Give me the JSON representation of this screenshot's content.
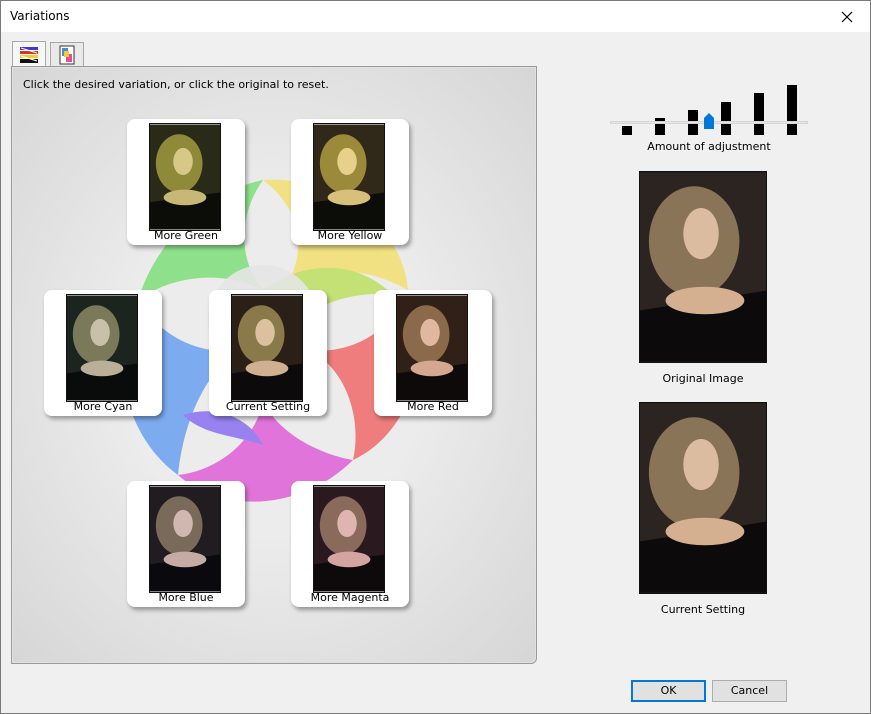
{
  "window": {
    "title": "Variations"
  },
  "tabs": [
    {
      "icon": "color-variations-icon"
    },
    {
      "icon": "brightness-variations-icon"
    }
  ],
  "instruction": "Click the desired variation, or click the original to reset.",
  "variations": {
    "more_green": "More Green",
    "more_yellow": "More Yellow",
    "more_cyan": "More Cyan",
    "current_setting": "Current Setting",
    "more_red": "More Red",
    "more_blue": "More Blue",
    "more_magenta": "More Magenta"
  },
  "adjustment": {
    "label": "Amount of adjustment",
    "levels": 6,
    "selected_level": 3
  },
  "preview": {
    "original_label": "Original Image",
    "current_label": "Current Setting"
  },
  "buttons": {
    "ok": "OK",
    "cancel": "Cancel"
  },
  "colors": {
    "accent": "#0078d7"
  }
}
